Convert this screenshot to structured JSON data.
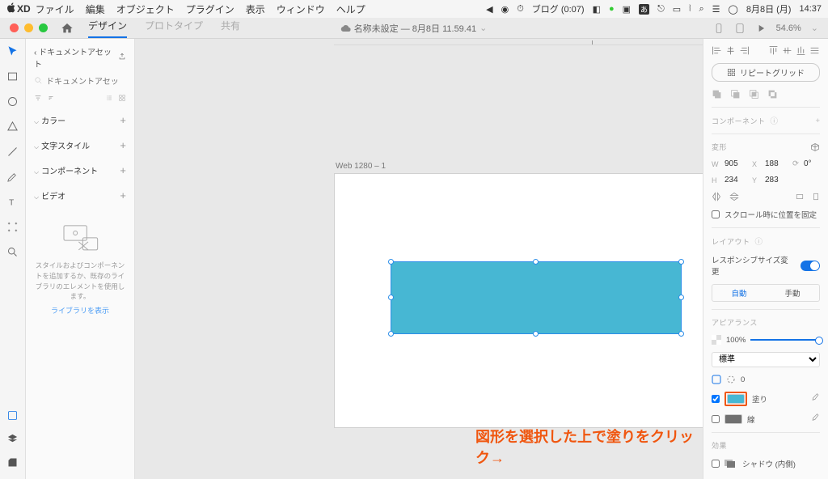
{
  "menubar": {
    "app": "XD",
    "items": [
      "ファイル",
      "編集",
      "オブジェクト",
      "プラグイン",
      "表示",
      "ウィンドウ",
      "ヘルプ"
    ],
    "status": {
      "blog": "ブログ (0:07)",
      "date": "8月8日 (月)",
      "time": "14:37"
    }
  },
  "titlebar": {
    "tabs": {
      "design": "デザイン",
      "prototype": "プロトタイプ",
      "share": "共有"
    },
    "filename": "名称未設定 — 8月8日 11.59.41",
    "zoom": "54.6%"
  },
  "tools": {
    "select": "選択",
    "rect": "長方形",
    "ellipse": "楕円",
    "triangle": "多角形",
    "line": "線",
    "pen": "ペン",
    "text": "テキスト",
    "artboard": "アートボード",
    "zoom": "ズーム"
  },
  "assets": {
    "heading": "ドキュメントアセット",
    "search_placeholder": "ドキュメントアセッ",
    "sections": {
      "color": "カラー",
      "textstyle": "文字スタイル",
      "component": "コンポーネント",
      "video": "ビデオ"
    },
    "empty_text": "スタイルおよびコンポーネントを追加するか、既存のライブラリのエレメントを使用します。",
    "link": "ライブラリを表示"
  },
  "canvas": {
    "artboard_label": "Web 1280 – 1"
  },
  "annotation": "図形を選択した上で塗りをクリック→",
  "inspector": {
    "repeat": "リピートグリッド",
    "component_head": "コンポーネント",
    "transform_head": "変形",
    "w": "905",
    "x": "188",
    "rot": "0°",
    "h": "234",
    "y": "283",
    "scroll_fix": "スクロール時に位置を固定",
    "layout_head": "レイアウト",
    "responsive": "レスポンシブサイズ変更",
    "auto": "自動",
    "manual": "手動",
    "appearance_head": "アピアランス",
    "opacity": "100%",
    "blend": "標準",
    "corner": "0",
    "fill": "塗り",
    "stroke": "線",
    "effects_head": "効果",
    "shadow": "シャドウ (内側)"
  }
}
